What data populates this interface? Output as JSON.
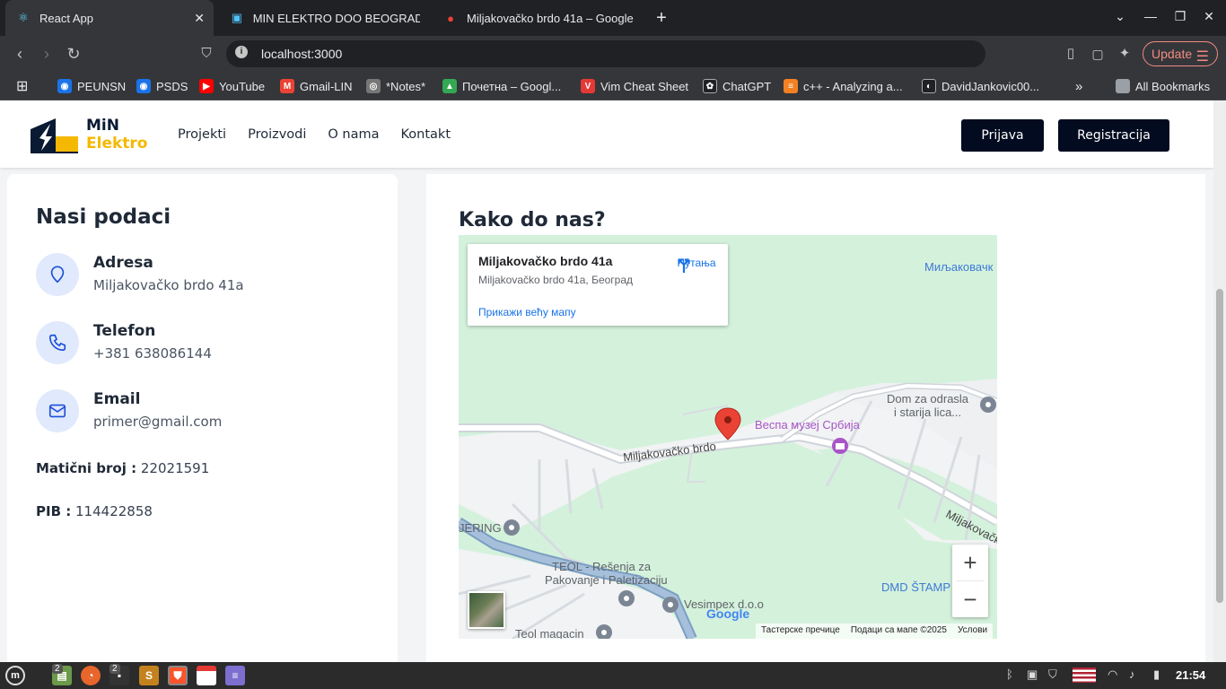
{
  "browser": {
    "tabs": [
      {
        "title": "React App",
        "icon": "react-icon"
      },
      {
        "title": "MIN ELEKTRO DOO BEOGRAD",
        "icon": "site-icon"
      },
      {
        "title": "Miljakovačko brdo 41a – Google",
        "icon": "maps-pin-icon"
      }
    ],
    "url": "localhost:3000",
    "update_label": "Update",
    "shield_badge": "1",
    "bookmarks": [
      {
        "label": "PEUNSN",
        "color": "#1a73e8"
      },
      {
        "label": "PSDS",
        "color": "#1a73e8"
      },
      {
        "label": "YouTube",
        "color": "#ff0000"
      },
      {
        "label": "Gmail-LIN",
        "color": "#ea4335"
      },
      {
        "label": "*Notes*",
        "color": "#888888"
      },
      {
        "label": "Почетна – Googl...",
        "color": "#34a853"
      },
      {
        "label": "Vim Cheat Sheet",
        "color": "#e53935"
      },
      {
        "label": "ChatGPT",
        "color": "#202124"
      },
      {
        "label": "c++ - Analyzing a...",
        "color": "#f48024"
      },
      {
        "label": "DavidJankovic00...",
        "color": "#202124"
      }
    ],
    "all_bookmarks": "All Bookmarks"
  },
  "site": {
    "logo": {
      "line1": "MiN",
      "line2": "Elektro"
    },
    "nav": [
      "Projekti",
      "Proizvodi",
      "O nama",
      "Kontakt"
    ],
    "login_label": "Prijava",
    "register_label": "Registracija"
  },
  "contact": {
    "heading": "Nasi podaci",
    "items": [
      {
        "title": "Adresa",
        "value": "Miljakovačko brdo 41a",
        "icon": "location-pin-icon"
      },
      {
        "title": "Telefon",
        "value": "+381 638086144",
        "icon": "phone-icon"
      },
      {
        "title": "Email",
        "value": "primer@gmail.com",
        "icon": "mail-icon"
      }
    ],
    "maticni_label": "Matični broj :",
    "maticni_value": "22021591",
    "pib_label": "PIB :",
    "pib_value": "114422858"
  },
  "map_section": {
    "heading": "Kako do nas?",
    "card_title": "Miljakovačko brdo 41a",
    "card_address": "Miljakovačko brdo 41a, Београд",
    "directions_label": "Путања",
    "larger_map_label": "Прикажи већу мапу",
    "labels": {
      "street_main": "Miljakovačko brdo",
      "street_right": "Miljakovačk",
      "area_top": "Миљаковачк",
      "dom": "Dom za odrasla",
      "dom2": "i starija lica...",
      "museum": "Веспа музеј Србија",
      "jering": "JERING",
      "teol1": "TEOL - Rešenja za",
      "teol2": "Pakovanje i Paletizaciju",
      "vesimpex": "Vesimpex d.o.o",
      "teol_mag": "Teol magacin",
      "dmd": "DMD ŠTAMP"
    },
    "google": "Google",
    "attribution": [
      "Тастерске пречице",
      "Подаци са мапе ©2025",
      "Услови"
    ]
  },
  "taskbar": {
    "clock": "21:54",
    "badge_a": "2",
    "badge_b": "2"
  }
}
